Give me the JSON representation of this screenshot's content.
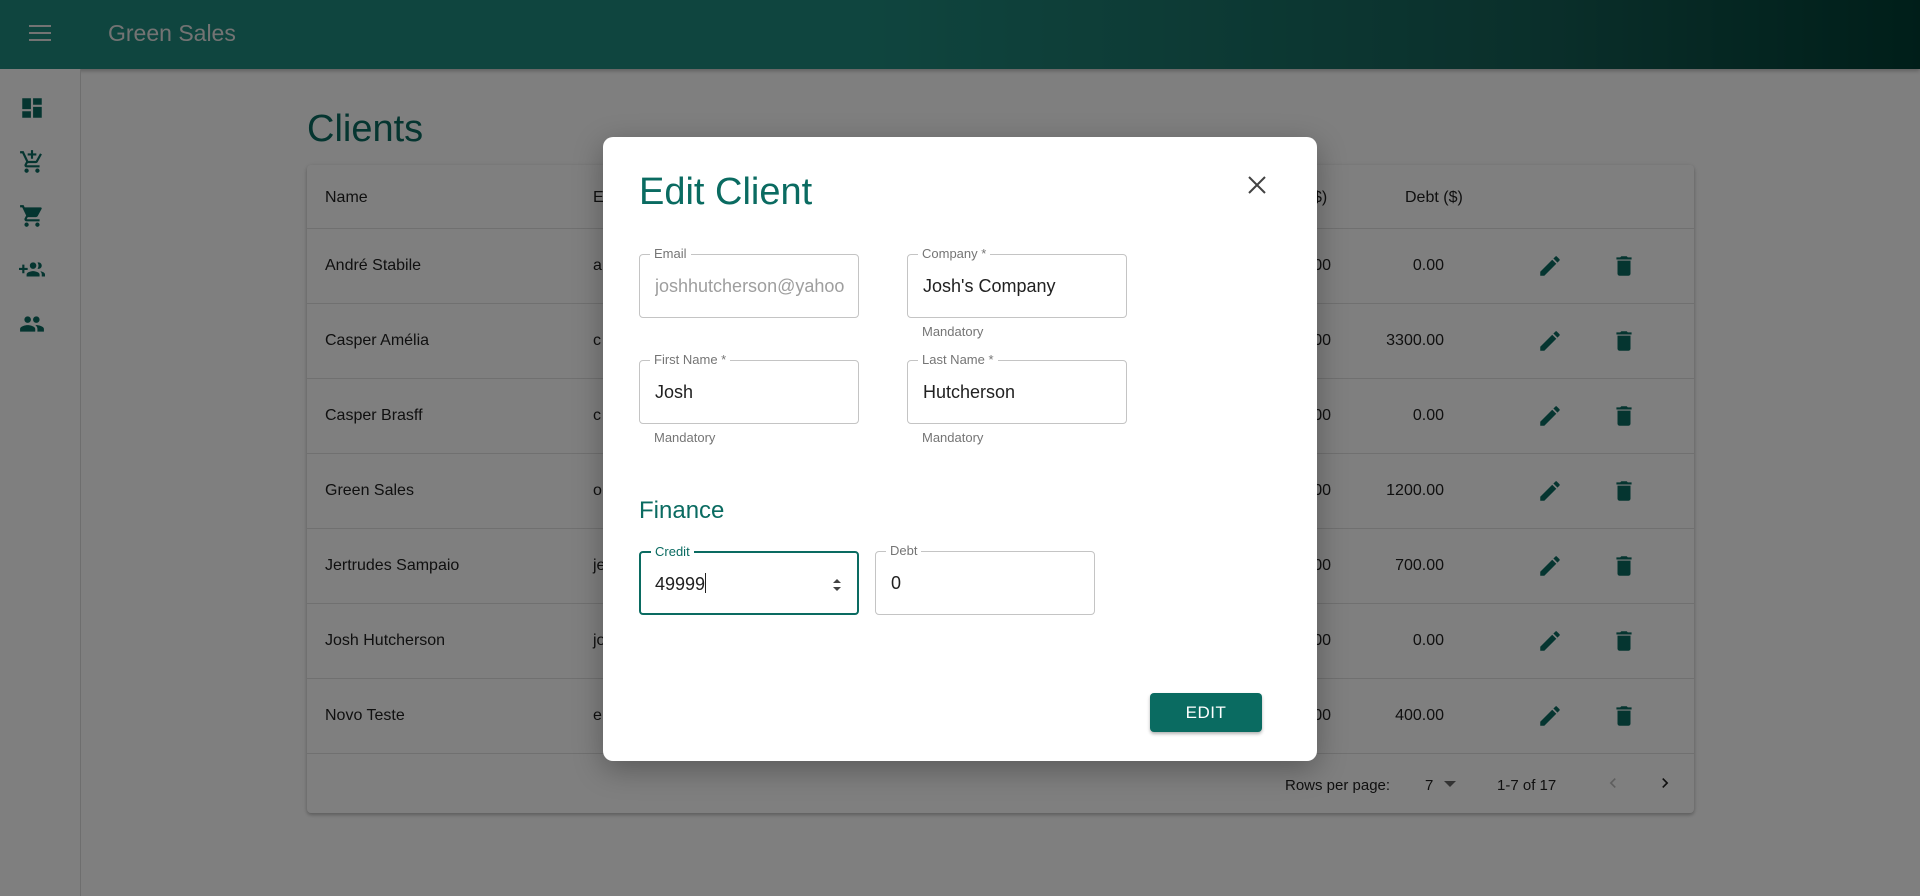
{
  "app": {
    "title": "Green Sales",
    "brand_color": "#1f8b7e",
    "accent_color": "#0a6b61"
  },
  "sidebar": {
    "items": [
      {
        "icon": "dashboard-icon"
      },
      {
        "icon": "add-shopping-cart-icon"
      },
      {
        "icon": "shopping-cart-icon"
      },
      {
        "icon": "group-add-icon"
      },
      {
        "icon": "people-icon"
      }
    ]
  },
  "page": {
    "title": "Clients"
  },
  "table": {
    "headers": {
      "name": "Name",
      "email": "E",
      "credit": "$)",
      "debt": "Debt ($)"
    },
    "rows": [
      {
        "name": "André Stabile",
        "email": "a",
        "credit": "00",
        "debt": "0.00"
      },
      {
        "name": "Casper Amélia",
        "email": "c",
        "credit": "00",
        "debt": "3300.00"
      },
      {
        "name": "Casper Brasff",
        "email": "c",
        "credit": "00",
        "debt": "0.00"
      },
      {
        "name": "Green Sales",
        "email": "o",
        "credit": "00",
        "debt": "1200.00"
      },
      {
        "name": "Jertrudes Sampaio",
        "email": "je",
        "credit": "00",
        "debt": "700.00"
      },
      {
        "name": "Josh Hutcherson",
        "email": "jo",
        "credit": "00",
        "debt": "0.00"
      },
      {
        "name": "Novo Teste",
        "email": "e",
        "credit": "00",
        "debt": "400.00"
      }
    ],
    "pagination": {
      "rows_per_page_label": "Rows per page:",
      "rows_per_page": "7",
      "range": "1-7 of 17"
    }
  },
  "modal": {
    "title": "Edit Client",
    "email": {
      "label": "Email",
      "value": "joshhutcherson@yahoo"
    },
    "company": {
      "label": "Company *",
      "value": "Josh's Company",
      "helper": "Mandatory"
    },
    "first_name": {
      "label": "First Name *",
      "value": "Josh",
      "helper": "Mandatory"
    },
    "last_name": {
      "label": "Last Name *",
      "value": "Hutcherson",
      "helper": "Mandatory"
    },
    "finance_title": "Finance",
    "credit": {
      "label": "Credit",
      "value": "49999"
    },
    "debt": {
      "label": "Debt",
      "value": "0"
    },
    "submit_label": "EDIT"
  }
}
